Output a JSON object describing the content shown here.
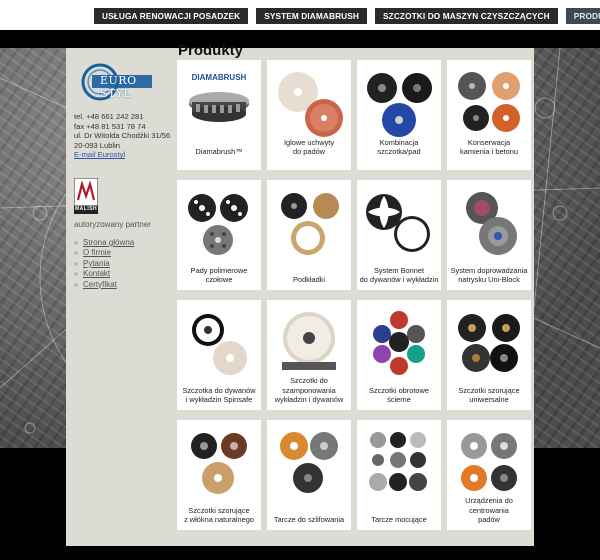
{
  "nav": {
    "items": [
      {
        "label": "USŁUGA RENOWACJI POSADZEK"
      },
      {
        "label": "SYSTEM DIAMABRUSH"
      },
      {
        "label": "SZCZOTKI DO MASZYN CZYSZCZĄCYCH"
      },
      {
        "label": "PRODUKTY",
        "active": true
      }
    ]
  },
  "sidebar": {
    "logo_text": "EURO STYL",
    "phone": "tel. +48 661 242 281",
    "fax": "fax +48 81 531 78 74",
    "address_street": "ul. Dr Witolda Chodźki 31/56",
    "address_city": "20-093 Lublin",
    "email_label": "E-mail Eurostyl",
    "partner_label": "autoryzowany partner",
    "partner_logo_text": "MALISH",
    "links": [
      "Strona główna",
      "O firmie",
      "Pytania",
      "Kontakt",
      "Certyfikat"
    ]
  },
  "main": {
    "title": "Produkty",
    "products": [
      {
        "label": "Diamabrush™",
        "brand_text": "DIAMABRUSH"
      },
      {
        "label": "Iglowe uchwyty\ndo padów"
      },
      {
        "label": "Kombinacja\nszczotka/pad"
      },
      {
        "label": "Konserwacja\nkamienia i betonu"
      },
      {
        "label": "Pady polimerowe czołowe"
      },
      {
        "label": "Podkładki"
      },
      {
        "label": "System Bonnet\ndo dywanów i wykładzin"
      },
      {
        "label": "System doprowadzania\nnatrysku Uni-Block"
      },
      {
        "label": "Szczotka do dywanów\ni wykładzin Spinsafe"
      },
      {
        "label": "Szczotki do\nszamponowania\nwykładzin i dywanów"
      },
      {
        "label": "Szczotki obrotowe ścierne"
      },
      {
        "label": "Szczotki szorujące\nuniwersalne"
      },
      {
        "label": "Szczotki szorujące\nz włókna naturalnego"
      },
      {
        "label": "Tarcze do szlifowania"
      },
      {
        "label": "Tarcze mocujące"
      },
      {
        "label": "Urządzenia do centrowania\npadów"
      }
    ]
  },
  "colors": {
    "panel_bg": "#dcdcd4",
    "nav_bg": "#2a2a2a",
    "nav_active_bg": "#3e4a53",
    "link_blue": "#2b55a4"
  }
}
